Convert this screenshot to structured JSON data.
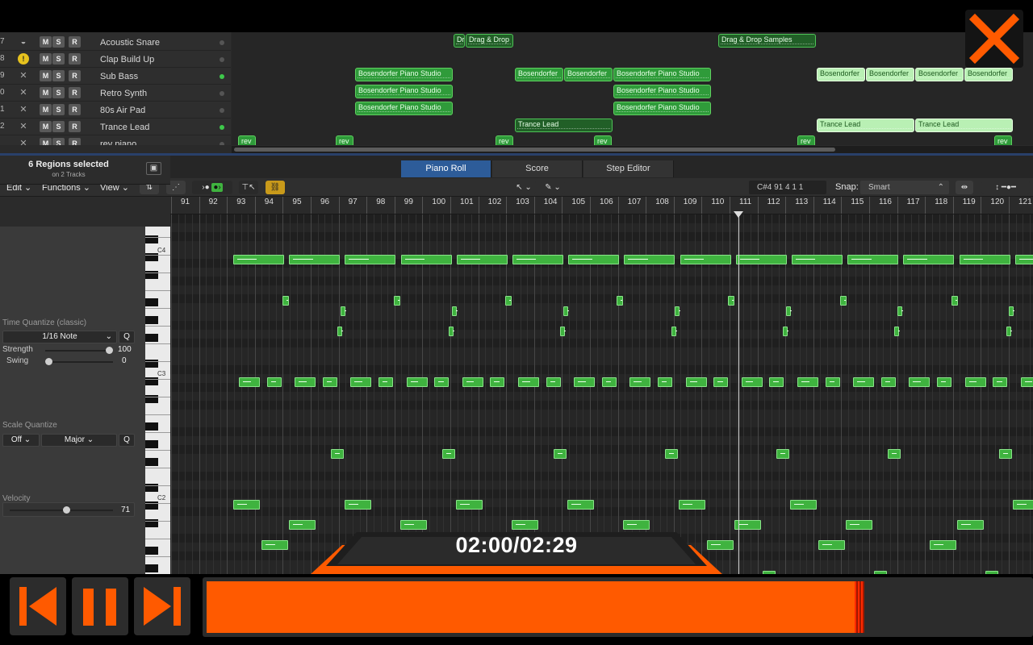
{
  "tracks": [
    {
      "num": "7",
      "icon": "drum-icon",
      "name": "Acoustic Snare",
      "active": false
    },
    {
      "num": "8",
      "icon": "clap-icon",
      "name": "Clap Build Up",
      "active": false
    },
    {
      "num": "9",
      "icon": "synth-icon",
      "name": "Sub Bass",
      "active": true
    },
    {
      "num": "0",
      "icon": "synth-icon",
      "name": "Retro Synth",
      "active": false
    },
    {
      "num": "1",
      "icon": "synth-icon",
      "name": "80s Air Pad",
      "active": false
    },
    {
      "num": "2",
      "icon": "synth-icon",
      "name": "Trance Lead",
      "active": true
    },
    {
      "num": "",
      "icon": "synth-icon",
      "name": "rev piano",
      "active": false
    }
  ],
  "track_buttons": {
    "mute": "M",
    "solo": "S",
    "record": "R"
  },
  "regions": [
    {
      "track": 0,
      "label": "Dr",
      "start": 562,
      "width": 14,
      "style": "dark"
    },
    {
      "track": 0,
      "label": "Drag & Drop",
      "start": 577,
      "width": 59,
      "style": "dark"
    },
    {
      "track": 0,
      "label": "Drag & Drop Samples",
      "start": 890,
      "width": 121,
      "style": "dark"
    },
    {
      "track": 2,
      "label": "Bosendorfer Piano Studio",
      "start": 440,
      "width": 121,
      "style": "normal"
    },
    {
      "track": 2,
      "label": "Bosendorfer",
      "start": 638,
      "width": 60,
      "style": "normal"
    },
    {
      "track": 2,
      "label": "Bosendorfer",
      "start": 699,
      "width": 60,
      "style": "normal"
    },
    {
      "track": 2,
      "label": "Bosendorfer Piano Studio",
      "start": 760,
      "width": 121,
      "style": "normal"
    },
    {
      "track": 2,
      "label": "Bosendorfer",
      "start": 1012,
      "width": 60,
      "style": "light"
    },
    {
      "track": 2,
      "label": "Bosendorfer",
      "start": 1073,
      "width": 60,
      "style": "light"
    },
    {
      "track": 2,
      "label": "Bosendorfer",
      "start": 1134,
      "width": 60,
      "style": "light"
    },
    {
      "track": 2,
      "label": "Bosendorfer",
      "start": 1195,
      "width": 60,
      "style": "light"
    },
    {
      "track": 3,
      "label": "Bosendorfer Piano Studio",
      "start": 440,
      "width": 121,
      "style": "normal"
    },
    {
      "track": 3,
      "label": "Bosendorfer Piano Studio",
      "start": 760,
      "width": 121,
      "style": "normal"
    },
    {
      "track": 4,
      "label": "Bosendorfer Piano Studio",
      "start": 440,
      "width": 121,
      "style": "normal"
    },
    {
      "track": 4,
      "label": "Bosendorfer Piano Studio",
      "start": 760,
      "width": 121,
      "style": "normal"
    },
    {
      "track": 5,
      "label": "Trance Lead",
      "start": 638,
      "width": 121,
      "style": "dark"
    },
    {
      "track": 5,
      "label": "Trance Lead",
      "start": 1012,
      "width": 121,
      "style": "light"
    },
    {
      "track": 5,
      "label": "Trance Lead",
      "start": 1134,
      "width": 121,
      "style": "light"
    },
    {
      "track": 6,
      "label": "rev",
      "start": 295,
      "width": 22,
      "style": "normal"
    },
    {
      "track": 6,
      "label": "rev",
      "start": 416,
      "width": 22,
      "style": "normal"
    },
    {
      "track": 6,
      "label": "rev",
      "start": 614,
      "width": 22,
      "style": "normal"
    },
    {
      "track": 6,
      "label": "rev",
      "start": 736,
      "width": 22,
      "style": "normal"
    },
    {
      "track": 6,
      "label": "rev",
      "start": 988,
      "width": 22,
      "style": "normal"
    },
    {
      "track": 6,
      "label": "rev",
      "start": 1232,
      "width": 22,
      "style": "normal"
    }
  ],
  "tabs": {
    "piano_roll": "Piano Roll",
    "score": "Score",
    "step_editor": "Step Editor"
  },
  "toolbar": {
    "edit": "Edit",
    "functions": "Functions",
    "view": "View",
    "position": "C#4   91 4 1 1",
    "snap_label": "Snap:",
    "snap_value": "Smart"
  },
  "inspector": {
    "selection_title": "6 Regions selected",
    "selection_sub": "on 2 Tracks",
    "time_quantize_label": "Time Quantize (classic)",
    "time_quantize_value": "1/16 Note",
    "q_button": "Q",
    "strength_label": "Strength",
    "strength_value": "100",
    "swing_label": "Swing",
    "swing_value": "0",
    "scale_quantize_label": "Scale Quantize",
    "scale_off": "Off",
    "scale_mode": "Major",
    "velocity_label": "Velocity",
    "velocity_value": "71"
  },
  "keyboard_labels": {
    "c4": "C4",
    "c3": "C3",
    "c2": "C2"
  },
  "ruler_bars": [
    "91",
    "92",
    "93",
    "94",
    "95",
    "96",
    "97",
    "98",
    "99",
    "100",
    "101",
    "102",
    "103",
    "104",
    "105",
    "106",
    "107",
    "108",
    "109",
    "110",
    "111",
    "112",
    "113",
    "114",
    "115",
    "116",
    "117",
    "118",
    "119",
    "120",
    "121"
  ],
  "player": {
    "time": "02:00/02:29",
    "progress_fraction": 0.8,
    "accent": "#ff5a00"
  },
  "colors": {
    "note": "#3fb33f",
    "tab_active": "#2d5c99",
    "accent": "#ff5a00"
  }
}
